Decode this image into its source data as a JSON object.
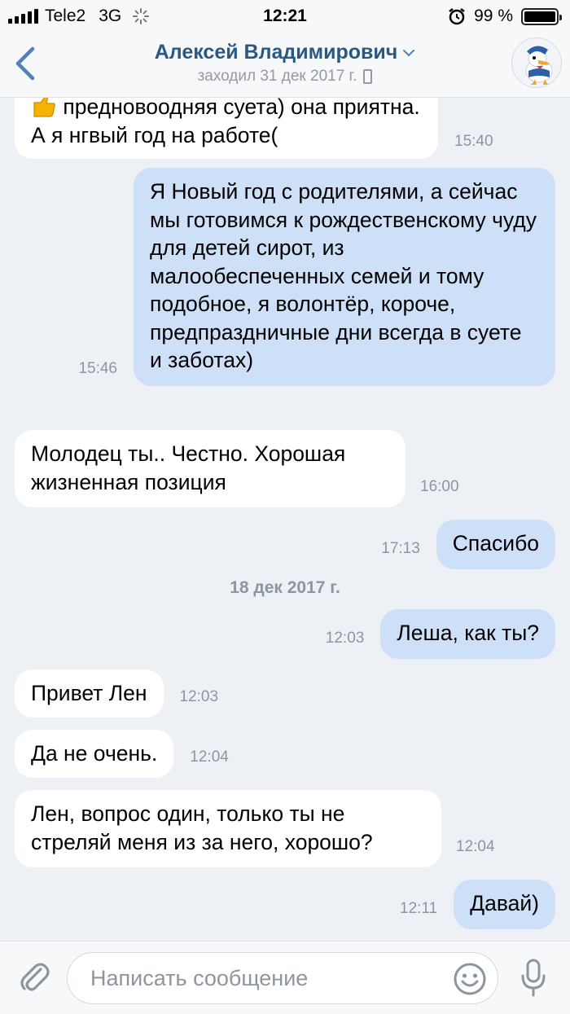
{
  "status_bar": {
    "carrier": "Tele2",
    "network": "3G",
    "time": "12:21",
    "battery_percent": "99 %",
    "battery_level": 0.99
  },
  "header": {
    "contact_name": "Алексей Владимирович",
    "last_seen": "заходил 31 дек 2017 г."
  },
  "messages": [
    {
      "direction": "in",
      "text": "предновоодняя суета) она приятна. А я нгвый год на работе(",
      "time": "15:40"
    },
    {
      "direction": "out",
      "text": "Я Новый год с родителями, а сейчас мы готовимся к рождественскому чуду для детей сирот, из малообеспеченных семей и тому подобное, я волонтёр, короче, предпраздничные дни всегда в суете и заботах)",
      "time": "15:46"
    },
    {
      "direction": "in",
      "text": "Молодец ты.. Честно. Хорошая жизненная позиция",
      "time": "16:00"
    },
    {
      "direction": "out",
      "text": "Спасибо",
      "time": "17:13"
    },
    {
      "direction": "out",
      "text": "Леша, как ты?",
      "time": "12:03"
    },
    {
      "direction": "in",
      "text": "Привет Лен",
      "time": "12:03"
    },
    {
      "direction": "in",
      "text": "Да не очень.",
      "time": "12:04"
    },
    {
      "direction": "in",
      "text": "Лен, вопрос один, только ты не стреляй меня из за него, хорошо?",
      "time": "12:04"
    },
    {
      "direction": "out",
      "text": "Давай)",
      "time": "12:11"
    }
  ],
  "date_separator": "18 дек 2017 г.",
  "composer": {
    "placeholder": "Написать сообщение"
  },
  "colors": {
    "accent": "#2a5885",
    "outgoing_bubble": "#cde0f7",
    "incoming_bubble": "#ffffff",
    "background": "#edf1f6"
  }
}
